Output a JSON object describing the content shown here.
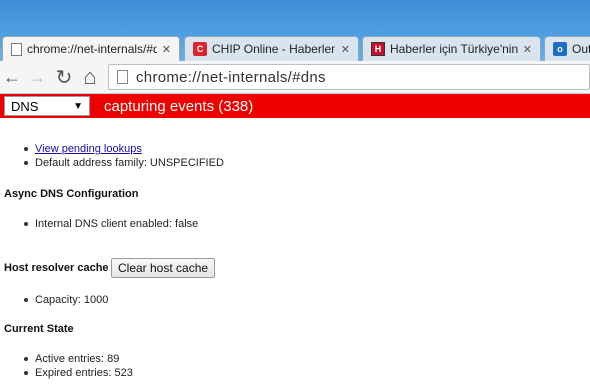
{
  "tabs": [
    {
      "title": "chrome://net-internals/#d",
      "favicon": "page-icon",
      "active": true
    },
    {
      "title": "CHIP Online - Haberler ve",
      "favicon": "chip-icon",
      "active": false
    },
    {
      "title": "Haberler için Türkiye'nin A",
      "favicon": "haberturk-icon",
      "active": false
    },
    {
      "title": "Outlo",
      "favicon": "outlook-icon",
      "active": false
    }
  ],
  "tab_close_glyph": "✕",
  "toolbar": {
    "back_icon": "←",
    "forward_icon": "→",
    "reload_icon": "↻",
    "home_icon": "⌂",
    "url": "chrome://net-internals/#dns"
  },
  "status_bar": {
    "view_selected": "DNS",
    "view_arrow": "▼",
    "status_text": "capturing events (338)",
    "color": "#ee0000"
  },
  "content": {
    "top_items": {
      "pending_link": "View pending lookups",
      "address_family": "Default address family: UNSPECIFIED"
    },
    "async_heading": "Async DNS Configuration",
    "async_item": "Internal DNS client enabled: false",
    "cache_heading": "Host resolver cache",
    "clear_button": "Clear host cache",
    "capacity": "Capacity: 1000",
    "state_heading": "Current State",
    "active_entries": "Active entries: 89",
    "expired_entries": "Expired entries: 523"
  }
}
